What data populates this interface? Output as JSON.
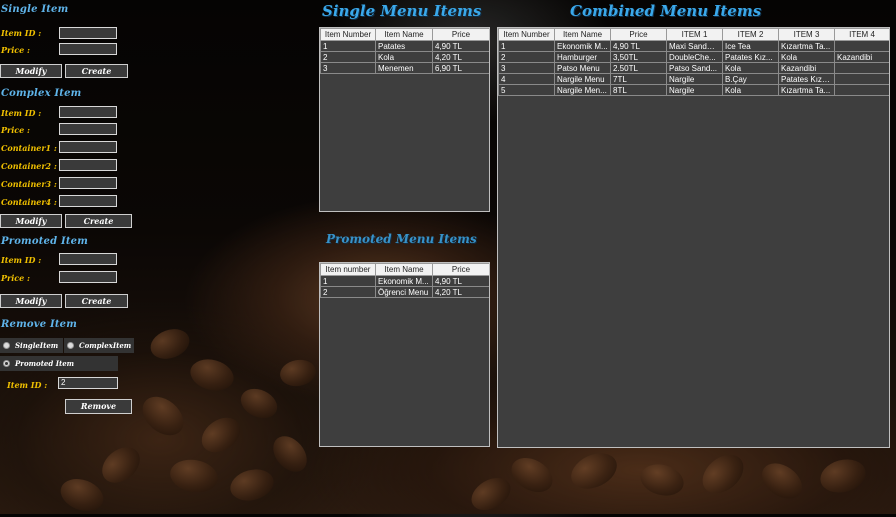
{
  "left_panel": {
    "single_item": {
      "title": "Single Item",
      "item_id_label": "Item ID :",
      "price_label": "Price :",
      "item_id_value": "",
      "price_value": "",
      "modify_label": "Modify",
      "create_label": "Create"
    },
    "complex_item": {
      "title": "Complex Item",
      "item_id_label": "Item ID :",
      "price_label": "Price :",
      "container1_label": "Container1 :",
      "container2_label": "Container2 :",
      "container3_label": "Container3 :",
      "container4_label": "Container4 :",
      "item_id_value": "",
      "price_value": "",
      "container1_value": "",
      "container2_value": "",
      "container3_value": "",
      "container4_value": "",
      "modify_label": "Modify",
      "create_label": "Create"
    },
    "promoted_item": {
      "title": "Promoted Item",
      "item_id_label": "Item ID :",
      "price_label": "Price :",
      "item_id_value": "",
      "price_value": "",
      "modify_label": "Modify",
      "create_label": "Create"
    },
    "remove_item": {
      "title": "Remove Item",
      "radio_single": "SingleItem",
      "radio_complex": "ComplexItem",
      "radio_promoted": "Promoted Item",
      "selected": "promoted",
      "item_id_label": "Item ID :",
      "item_id_value": "2",
      "remove_label": "Remove"
    }
  },
  "single_menu": {
    "title": "Single Menu Items",
    "columns": [
      "Item Number",
      "Item Name",
      "Price"
    ],
    "rows": [
      [
        "1",
        "Patates",
        "4,90 TL"
      ],
      [
        "2",
        "Kola",
        "4,20 TL"
      ],
      [
        "3",
        "Menemen",
        "6,90 TL"
      ]
    ]
  },
  "promoted_menu": {
    "title": "Promoted Menu Items",
    "columns": [
      "Item number",
      "Item Name",
      "Price"
    ],
    "rows": [
      [
        "1",
        "Ekonomik M...",
        "4,90 TL"
      ],
      [
        "2",
        "Öğrenci Menu",
        "4,20 TL"
      ]
    ]
  },
  "combined_menu": {
    "title": "Combined Menu Items",
    "columns": [
      "Item Number",
      "Item Name",
      "Price",
      "ITEM 1",
      "ITEM 2",
      "ITEM 3",
      "ITEM 4"
    ],
    "rows": [
      [
        "1",
        "Ekonomik M...",
        "4,90 TL",
        "Maxi Sandwi...",
        "Ice Tea",
        "Kızartma Ta...",
        ""
      ],
      [
        "2",
        "Hamburger",
        "3,50TL",
        "DoubleChe...",
        "Patates Kız...",
        "Kola",
        "Kazandibi"
      ],
      [
        "3",
        "Patso Menu",
        "2.50TL",
        "Patso Sand...",
        "Kola",
        "Kazandibi",
        ""
      ],
      [
        "4",
        "Nargile Menu",
        "7TL",
        "Nargile",
        "B.Çay",
        "Patates Kıza...",
        ""
      ],
      [
        "5",
        "Nargile Men...",
        "8TL",
        "Nargile",
        "Kola",
        "Kızartma Ta...",
        ""
      ]
    ]
  }
}
